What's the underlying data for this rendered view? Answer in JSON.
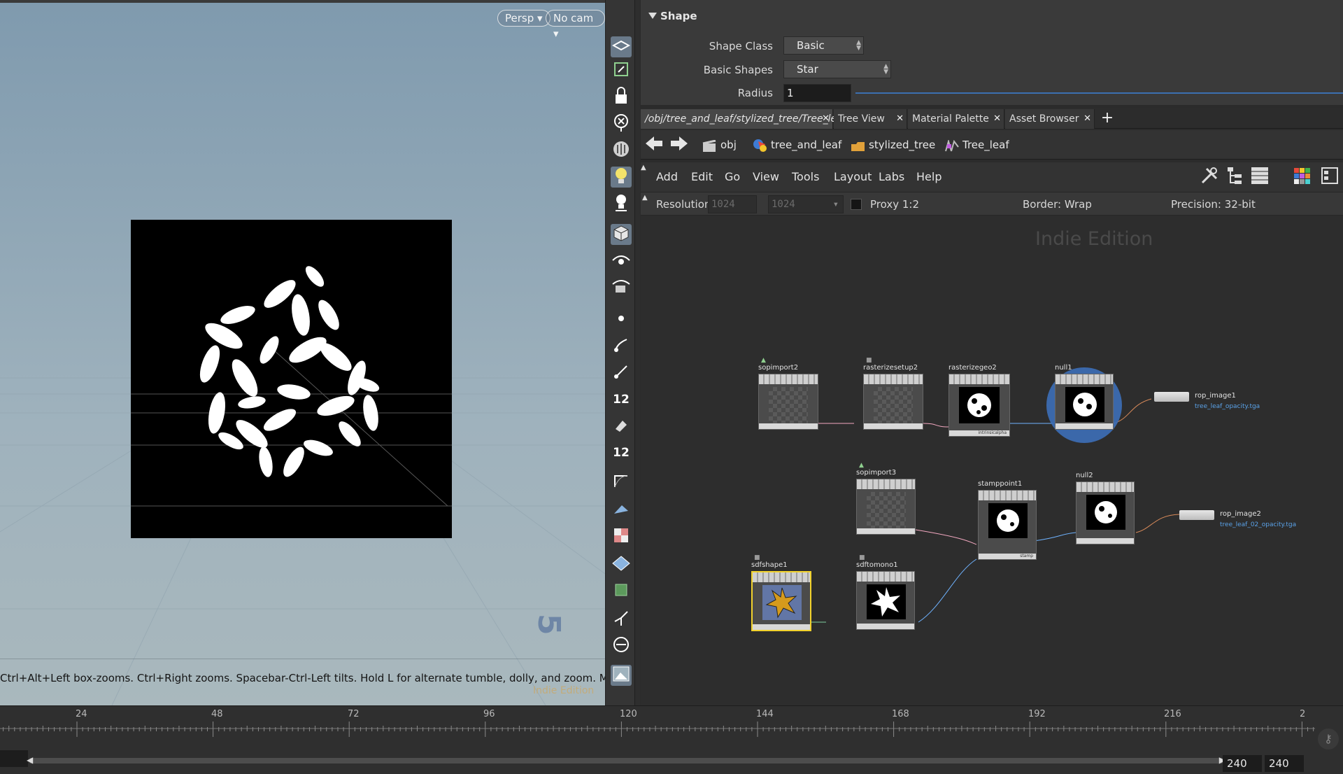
{
  "viewport": {
    "persp_label": "Persp",
    "cam_label": "No cam",
    "status_text": "Ctrl+Alt+Left box-zooms. Ctrl+Right zooms. Spacebar-Ctrl-Left tilts. Hold L for alternate tumble, dolly, and zoom. M for First",
    "watermark": "Indie Edition",
    "badge_12a": "12",
    "badge_12b": "12"
  },
  "params": {
    "section_title": "Shape",
    "shape_class_label": "Shape Class",
    "shape_class_value": "Basic",
    "basic_shapes_label": "Basic Shapes",
    "basic_shapes_value": "Star",
    "radius_label": "Radius",
    "radius_value": "1"
  },
  "tabs": [
    {
      "label": "/obj/tree_and_leaf/stylized_tree/Tree_leaf"
    },
    {
      "label": "Tree View"
    },
    {
      "label": "Material Palette"
    },
    {
      "label": "Asset Browser"
    }
  ],
  "path": {
    "items": [
      "obj",
      "tree_and_leaf",
      "stylized_tree",
      "Tree_leaf"
    ]
  },
  "menu": {
    "items": [
      "Add",
      "Edit",
      "Go",
      "View",
      "Tools",
      "Layout",
      "Labs",
      "Help"
    ]
  },
  "options": {
    "resolution_label": "Resolution",
    "res_x": "1024",
    "res_y": "1024",
    "proxy_label": "Proxy 1:2",
    "border_label": "Border: Wrap",
    "precision_label": "Precision: 32-bit"
  },
  "network": {
    "watermark": "Indie Edition",
    "nodes": {
      "sopimport2": "sopimport2",
      "rasterizesetup2": "rasterizesetup2",
      "rasterizegeo2": "rasterizegeo2",
      "null1": "null1",
      "sopimport3": "sopimport3",
      "stamppoint1": "stamppoint1",
      "null2": "null2",
      "sdfshape1": "sdfshape1",
      "sdftomono1": "sdftomono1"
    },
    "rops": [
      {
        "name": "rop_image1",
        "file": "tree_leaf_opacity.tga"
      },
      {
        "name": "rop_image2",
        "file": "tree_leaf_02_opacity.tga"
      }
    ]
  },
  "timeline": {
    "ticks": [
      "24",
      "48",
      "72",
      "96",
      "120",
      "144",
      "168",
      "192",
      "216",
      "2"
    ],
    "end_frame": "240",
    "global_end": "240"
  }
}
